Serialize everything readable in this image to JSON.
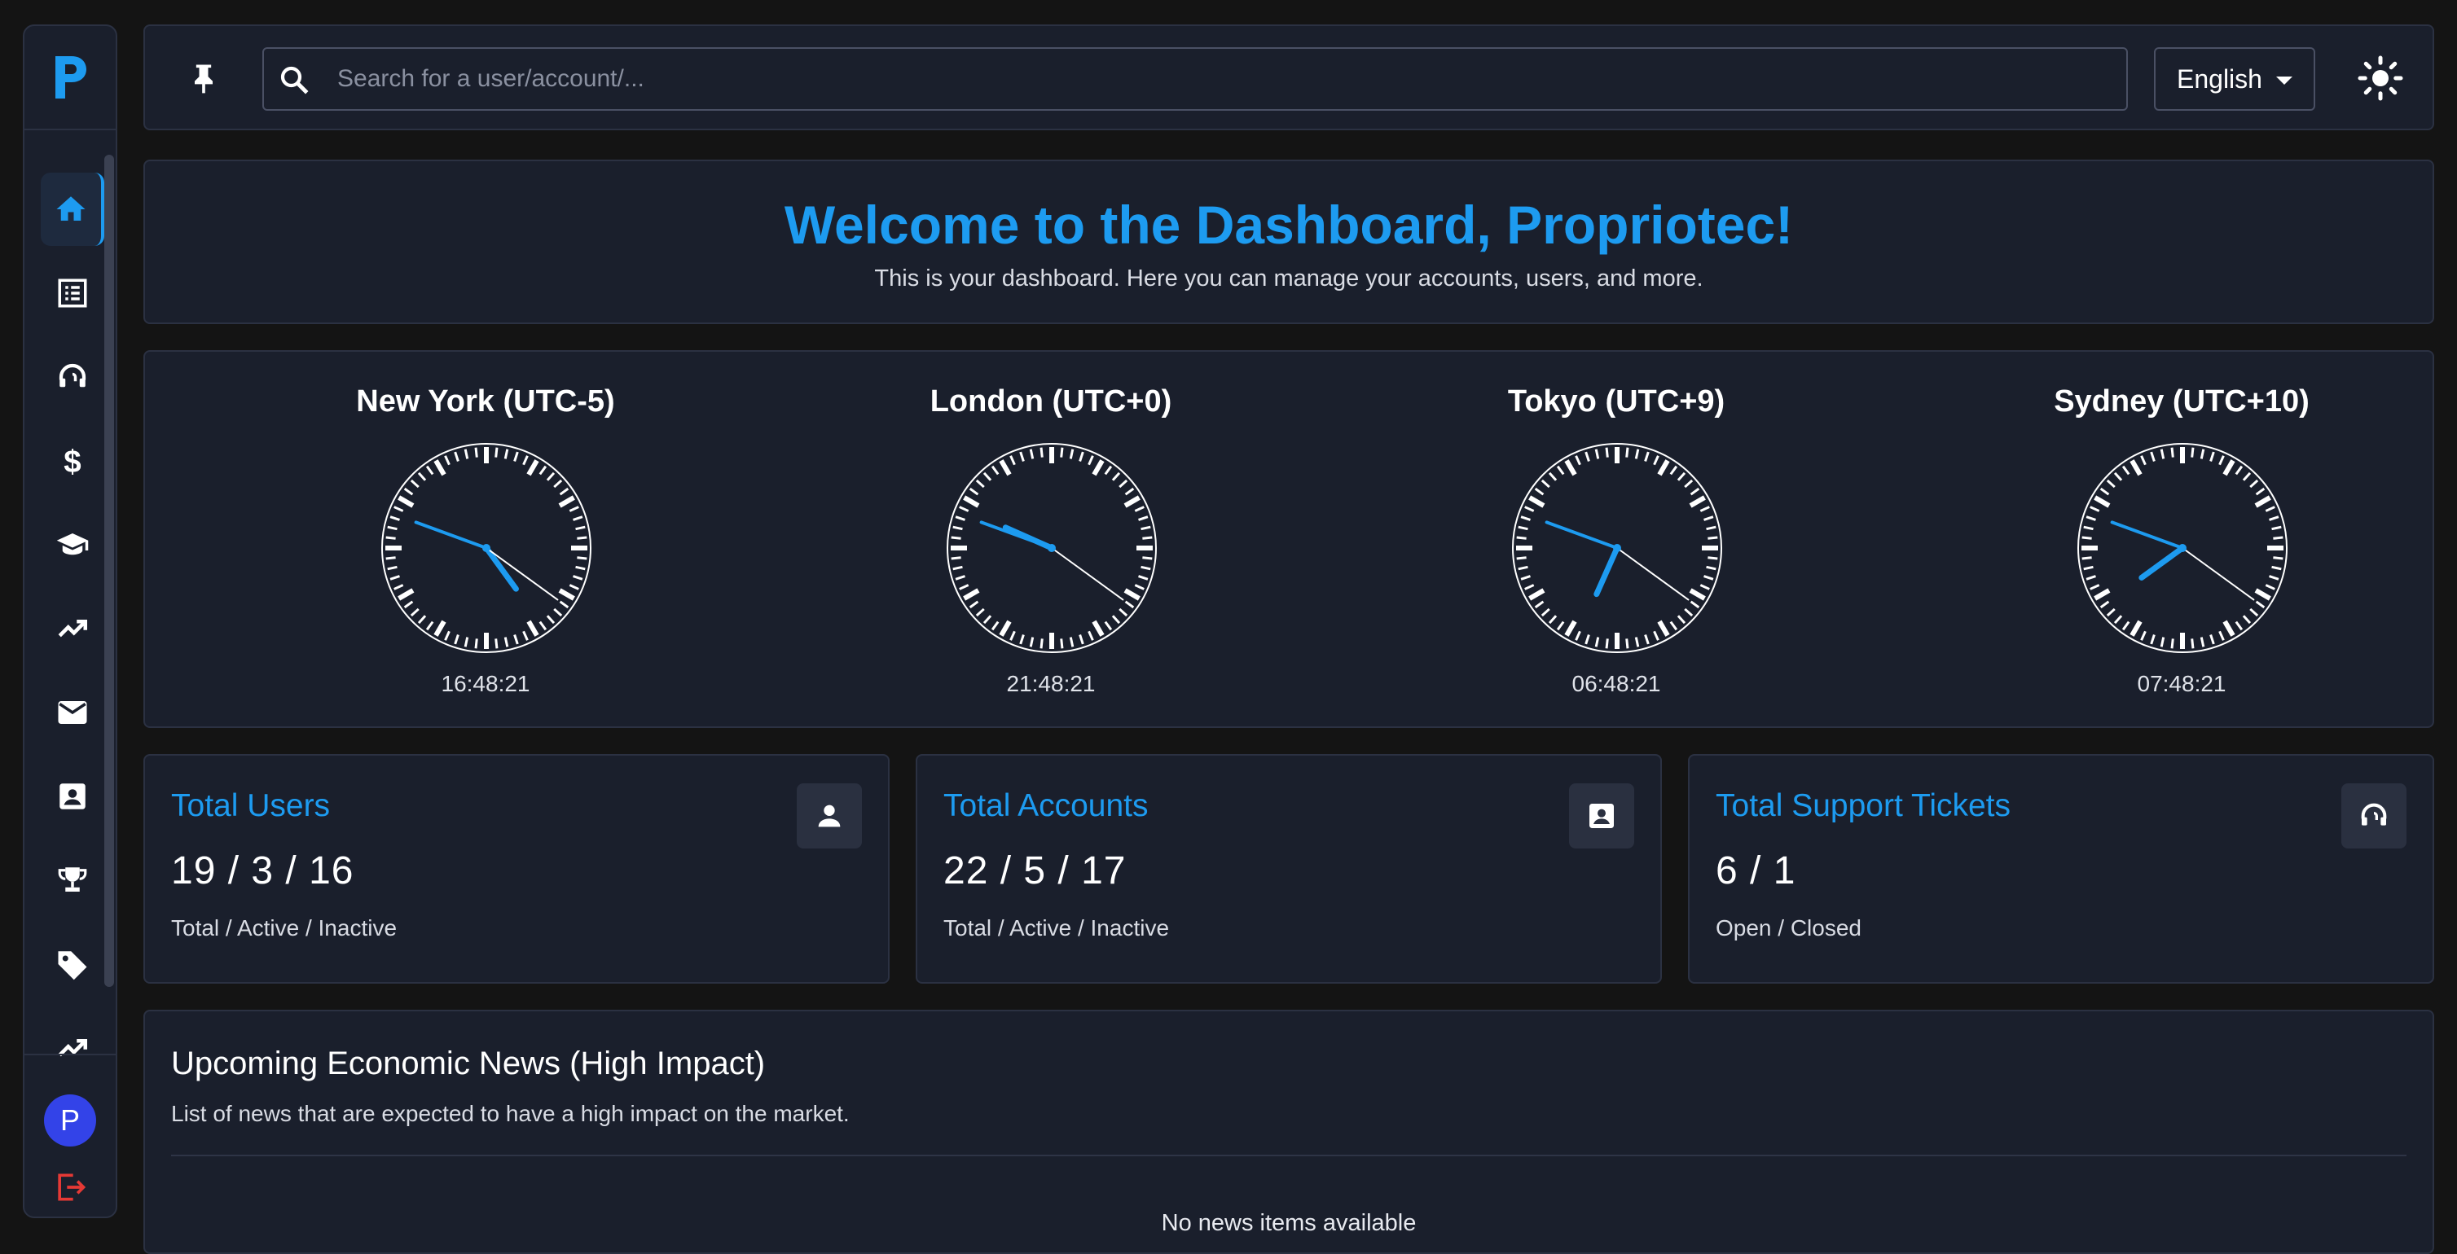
{
  "colors": {
    "accent": "#1d9bf0",
    "panel": "#1a1f2c",
    "border": "#2b3142",
    "background": "#141414",
    "avatar": "#3343e8",
    "logout": "#e53935"
  },
  "sidebar": {
    "logo_icon": "p-logo-icon",
    "items": [
      {
        "icon": "home-icon",
        "active": true
      },
      {
        "icon": "list-icon"
      },
      {
        "icon": "support-headset-icon"
      },
      {
        "icon": "dollar-icon"
      },
      {
        "icon": "graduation-cap-icon"
      },
      {
        "icon": "trending-up-icon"
      },
      {
        "icon": "mail-icon"
      },
      {
        "icon": "contact-card-icon"
      },
      {
        "icon": "trophy-icon"
      },
      {
        "icon": "tag-icon"
      },
      {
        "icon": "trending-up-icon"
      }
    ],
    "avatar_letter": "P",
    "logout_icon": "logout-icon"
  },
  "topbar": {
    "pin_icon": "pin-icon",
    "search_placeholder": "Search for a user/account/...",
    "language": "English",
    "theme_icon": "sun-icon"
  },
  "welcome": {
    "title": "Welcome to the Dashboard, Propriotec!",
    "subtitle": "This is your dashboard. Here you can manage your accounts, users, and more."
  },
  "clocks": [
    {
      "city": "New York (UTC-5)",
      "time": "16:48:21"
    },
    {
      "city": "London (UTC+0)",
      "time": "21:48:21"
    },
    {
      "city": "Tokyo (UTC+9)",
      "time": "06:48:21"
    },
    {
      "city": "Sydney (UTC+10)",
      "time": "07:48:21"
    }
  ],
  "stats": [
    {
      "title": "Total Users",
      "value": "19 / 3 / 16",
      "label": "Total / Active / Inactive",
      "icon": "user-icon"
    },
    {
      "title": "Total Accounts",
      "value": "22 / 5 / 17",
      "label": "Total / Active / Inactive",
      "icon": "contact-card-icon"
    },
    {
      "title": "Total Support Tickets",
      "value": "6 / 1",
      "label": "Open / Closed",
      "icon": "support-headset-icon"
    }
  ],
  "news": {
    "title": "Upcoming Economic News (High Impact)",
    "subtitle": "List of news that are expected to have a high impact on the market.",
    "empty": "No news items available"
  }
}
